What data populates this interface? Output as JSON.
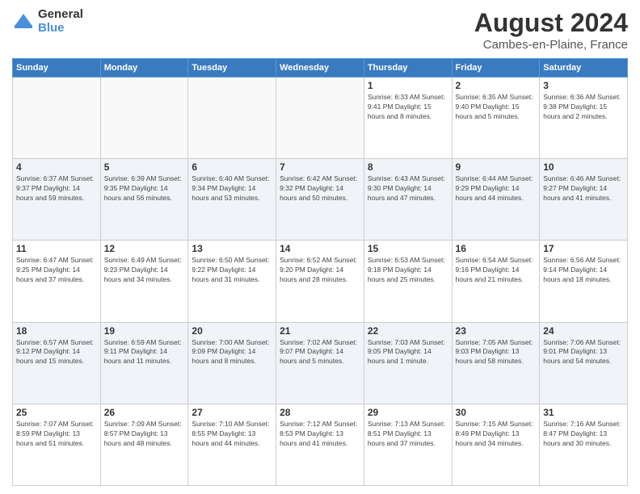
{
  "logo": {
    "general": "General",
    "blue": "Blue"
  },
  "header": {
    "title": "August 2024",
    "subtitle": "Cambes-en-Plaine, France"
  },
  "weekdays": [
    "Sunday",
    "Monday",
    "Tuesday",
    "Wednesday",
    "Thursday",
    "Friday",
    "Saturday"
  ],
  "weeks": [
    [
      {
        "day": "",
        "info": ""
      },
      {
        "day": "",
        "info": ""
      },
      {
        "day": "",
        "info": ""
      },
      {
        "day": "",
        "info": ""
      },
      {
        "day": "1",
        "info": "Sunrise: 6:33 AM\nSunset: 9:41 PM\nDaylight: 15 hours\nand 8 minutes."
      },
      {
        "day": "2",
        "info": "Sunrise: 6:35 AM\nSunset: 9:40 PM\nDaylight: 15 hours\nand 5 minutes."
      },
      {
        "day": "3",
        "info": "Sunrise: 6:36 AM\nSunset: 9:38 PM\nDaylight: 15 hours\nand 2 minutes."
      }
    ],
    [
      {
        "day": "4",
        "info": "Sunrise: 6:37 AM\nSunset: 9:37 PM\nDaylight: 14 hours\nand 59 minutes."
      },
      {
        "day": "5",
        "info": "Sunrise: 6:39 AM\nSunset: 9:35 PM\nDaylight: 14 hours\nand 56 minutes."
      },
      {
        "day": "6",
        "info": "Sunrise: 6:40 AM\nSunset: 9:34 PM\nDaylight: 14 hours\nand 53 minutes."
      },
      {
        "day": "7",
        "info": "Sunrise: 6:42 AM\nSunset: 9:32 PM\nDaylight: 14 hours\nand 50 minutes."
      },
      {
        "day": "8",
        "info": "Sunrise: 6:43 AM\nSunset: 9:30 PM\nDaylight: 14 hours\nand 47 minutes."
      },
      {
        "day": "9",
        "info": "Sunrise: 6:44 AM\nSunset: 9:29 PM\nDaylight: 14 hours\nand 44 minutes."
      },
      {
        "day": "10",
        "info": "Sunrise: 6:46 AM\nSunset: 9:27 PM\nDaylight: 14 hours\nand 41 minutes."
      }
    ],
    [
      {
        "day": "11",
        "info": "Sunrise: 6:47 AM\nSunset: 9:25 PM\nDaylight: 14 hours\nand 37 minutes."
      },
      {
        "day": "12",
        "info": "Sunrise: 6:49 AM\nSunset: 9:23 PM\nDaylight: 14 hours\nand 34 minutes."
      },
      {
        "day": "13",
        "info": "Sunrise: 6:50 AM\nSunset: 9:22 PM\nDaylight: 14 hours\nand 31 minutes."
      },
      {
        "day": "14",
        "info": "Sunrise: 6:52 AM\nSunset: 9:20 PM\nDaylight: 14 hours\nand 28 minutes."
      },
      {
        "day": "15",
        "info": "Sunrise: 6:53 AM\nSunset: 9:18 PM\nDaylight: 14 hours\nand 25 minutes."
      },
      {
        "day": "16",
        "info": "Sunrise: 6:54 AM\nSunset: 9:16 PM\nDaylight: 14 hours\nand 21 minutes."
      },
      {
        "day": "17",
        "info": "Sunrise: 6:56 AM\nSunset: 9:14 PM\nDaylight: 14 hours\nand 18 minutes."
      }
    ],
    [
      {
        "day": "18",
        "info": "Sunrise: 6:57 AM\nSunset: 9:12 PM\nDaylight: 14 hours\nand 15 minutes."
      },
      {
        "day": "19",
        "info": "Sunrise: 6:59 AM\nSunset: 9:11 PM\nDaylight: 14 hours\nand 11 minutes."
      },
      {
        "day": "20",
        "info": "Sunrise: 7:00 AM\nSunset: 9:09 PM\nDaylight: 14 hours\nand 8 minutes."
      },
      {
        "day": "21",
        "info": "Sunrise: 7:02 AM\nSunset: 9:07 PM\nDaylight: 14 hours\nand 5 minutes."
      },
      {
        "day": "22",
        "info": "Sunrise: 7:03 AM\nSunset: 9:05 PM\nDaylight: 14 hours\nand 1 minute."
      },
      {
        "day": "23",
        "info": "Sunrise: 7:05 AM\nSunset: 9:03 PM\nDaylight: 13 hours\nand 58 minutes."
      },
      {
        "day": "24",
        "info": "Sunrise: 7:06 AM\nSunset: 9:01 PM\nDaylight: 13 hours\nand 54 minutes."
      }
    ],
    [
      {
        "day": "25",
        "info": "Sunrise: 7:07 AM\nSunset: 8:59 PM\nDaylight: 13 hours\nand 51 minutes."
      },
      {
        "day": "26",
        "info": "Sunrise: 7:09 AM\nSunset: 8:57 PM\nDaylight: 13 hours\nand 48 minutes."
      },
      {
        "day": "27",
        "info": "Sunrise: 7:10 AM\nSunset: 8:55 PM\nDaylight: 13 hours\nand 44 minutes."
      },
      {
        "day": "28",
        "info": "Sunrise: 7:12 AM\nSunset: 8:53 PM\nDaylight: 13 hours\nand 41 minutes."
      },
      {
        "day": "29",
        "info": "Sunrise: 7:13 AM\nSunset: 8:51 PM\nDaylight: 13 hours\nand 37 minutes."
      },
      {
        "day": "30",
        "info": "Sunrise: 7:15 AM\nSunset: 8:49 PM\nDaylight: 13 hours\nand 34 minutes."
      },
      {
        "day": "31",
        "info": "Sunrise: 7:16 AM\nSunset: 8:47 PM\nDaylight: 13 hours\nand 30 minutes."
      }
    ]
  ]
}
